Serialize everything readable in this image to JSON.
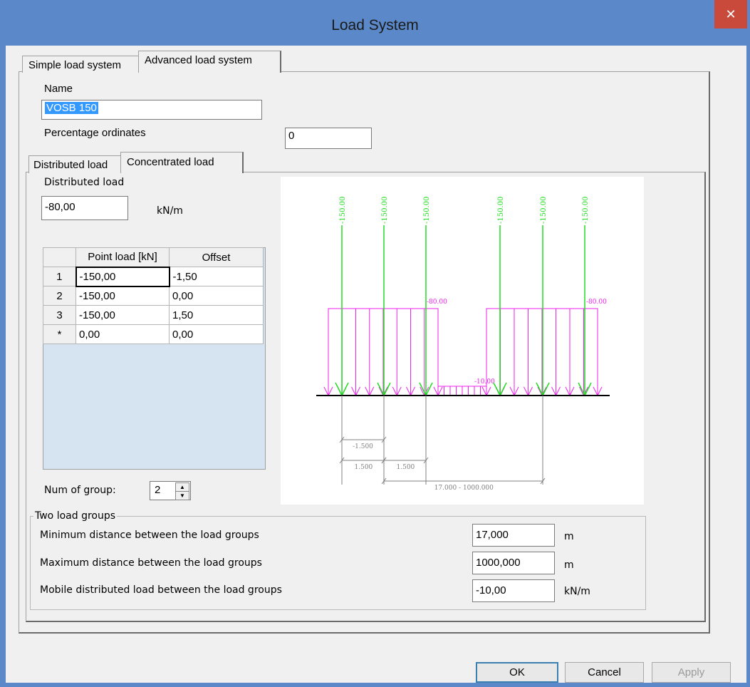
{
  "window": {
    "title": "Load System",
    "close_glyph": "✕"
  },
  "tabs": {
    "simple": "Simple load system",
    "advanced": "Advanced load system"
  },
  "name": {
    "label": "Name",
    "value": "VOSB 150"
  },
  "percentage": {
    "label": "Percentage ordinates",
    "value": "0"
  },
  "subtabs": {
    "distributed": "Distributed load",
    "concentrated": "Concentrated load"
  },
  "distributed": {
    "label": "Distributed load",
    "value": "-80,00",
    "unit": "kN/m"
  },
  "table": {
    "headers": [
      "Point load [kN]",
      "Offset"
    ],
    "rows": [
      {
        "idx": "1",
        "load": "-150,00",
        "offset": "-1,50"
      },
      {
        "idx": "2",
        "load": "-150,00",
        "offset": "0,00"
      },
      {
        "idx": "3",
        "load": "-150,00",
        "offset": "1,50"
      },
      {
        "idx": "*",
        "load": "0,00",
        "offset": "0,00"
      }
    ]
  },
  "num_group": {
    "label": "Num of group:",
    "value": "2"
  },
  "two_groups": {
    "legend": "Two load groups",
    "min_label": "Minimum distance between the load groups",
    "min_value": "17,000",
    "min_unit": "m",
    "max_label": "Maximum distance between the load groups",
    "max_value": "1000,000",
    "max_unit": "m",
    "mobile_label": "Mobile distributed load between the load groups",
    "mobile_value": "-10,00",
    "mobile_unit": "kN/m"
  },
  "diagram": {
    "point_labels": [
      "-150.00",
      "-150.00",
      "-150.00",
      "-150.00",
      "-150.00",
      "-150.00"
    ],
    "dist_labels": [
      "-80.00",
      "-80.00"
    ],
    "mobile_label": "-10.00",
    "dim_labels": [
      "-1.500",
      "1.500",
      "1.500",
      "17.000 - 1000.000"
    ],
    "colors": {
      "point": "#22dd22",
      "distributed": "#ee22ee",
      "dimension": "#808080"
    }
  },
  "buttons": {
    "ok": "OK",
    "cancel": "Cancel",
    "apply": "Apply"
  }
}
